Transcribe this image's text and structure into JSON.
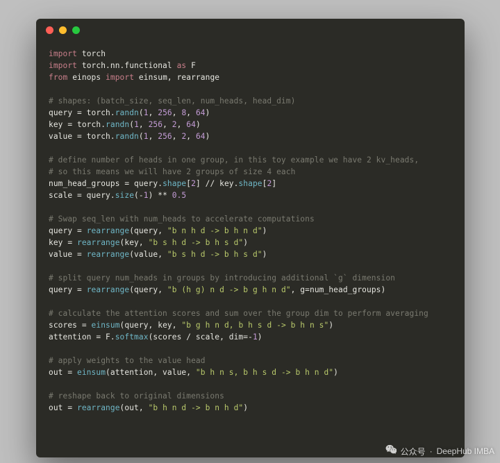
{
  "code": {
    "lines": [
      [
        {
          "t": "import ",
          "c": "kw"
        },
        {
          "t": "torch",
          "c": "mod"
        }
      ],
      [
        {
          "t": "import ",
          "c": "kw"
        },
        {
          "t": "torch.nn.functional ",
          "c": "mod"
        },
        {
          "t": "as ",
          "c": "kw"
        },
        {
          "t": "F",
          "c": "mod"
        }
      ],
      [
        {
          "t": "from ",
          "c": "kw"
        },
        {
          "t": "einops ",
          "c": "mod"
        },
        {
          "t": "import ",
          "c": "kw"
        },
        {
          "t": "einsum, rearrange",
          "c": "mod"
        }
      ],
      [],
      [
        {
          "t": "# shapes: (batch_size, seq_len, num_heads, head_dim)",
          "c": "cmt"
        }
      ],
      [
        {
          "t": "query = torch.",
          "c": "id"
        },
        {
          "t": "randn",
          "c": "fn"
        },
        {
          "t": "(",
          "c": "op"
        },
        {
          "t": "1",
          "c": "num"
        },
        {
          "t": ", ",
          "c": "op"
        },
        {
          "t": "256",
          "c": "num"
        },
        {
          "t": ", ",
          "c": "op"
        },
        {
          "t": "8",
          "c": "num"
        },
        {
          "t": ", ",
          "c": "op"
        },
        {
          "t": "64",
          "c": "num"
        },
        {
          "t": ")",
          "c": "op"
        }
      ],
      [
        {
          "t": "key = torch.",
          "c": "id"
        },
        {
          "t": "randn",
          "c": "fn"
        },
        {
          "t": "(",
          "c": "op"
        },
        {
          "t": "1",
          "c": "num"
        },
        {
          "t": ", ",
          "c": "op"
        },
        {
          "t": "256",
          "c": "num"
        },
        {
          "t": ", ",
          "c": "op"
        },
        {
          "t": "2",
          "c": "num"
        },
        {
          "t": ", ",
          "c": "op"
        },
        {
          "t": "64",
          "c": "num"
        },
        {
          "t": ")",
          "c": "op"
        }
      ],
      [
        {
          "t": "value = torch.",
          "c": "id"
        },
        {
          "t": "randn",
          "c": "fn"
        },
        {
          "t": "(",
          "c": "op"
        },
        {
          "t": "1",
          "c": "num"
        },
        {
          "t": ", ",
          "c": "op"
        },
        {
          "t": "256",
          "c": "num"
        },
        {
          "t": ", ",
          "c": "op"
        },
        {
          "t": "2",
          "c": "num"
        },
        {
          "t": ", ",
          "c": "op"
        },
        {
          "t": "64",
          "c": "num"
        },
        {
          "t": ")",
          "c": "op"
        }
      ],
      [],
      [
        {
          "t": "# define number of heads in one group, in this toy example we have 2 kv_heads,",
          "c": "cmt"
        }
      ],
      [
        {
          "t": "# so this means we will have 2 groups of size 4 each",
          "c": "cmt"
        }
      ],
      [
        {
          "t": "num_head_groups = query.",
          "c": "id"
        },
        {
          "t": "shape",
          "c": "fn"
        },
        {
          "t": "[",
          "c": "op"
        },
        {
          "t": "2",
          "c": "num"
        },
        {
          "t": "] // key.",
          "c": "id"
        },
        {
          "t": "shape",
          "c": "fn"
        },
        {
          "t": "[",
          "c": "op"
        },
        {
          "t": "2",
          "c": "num"
        },
        {
          "t": "]",
          "c": "op"
        }
      ],
      [
        {
          "t": "scale = query.",
          "c": "id"
        },
        {
          "t": "size",
          "c": "fn"
        },
        {
          "t": "(-",
          "c": "op"
        },
        {
          "t": "1",
          "c": "num"
        },
        {
          "t": ") ** ",
          "c": "op"
        },
        {
          "t": "0.5",
          "c": "num"
        }
      ],
      [],
      [
        {
          "t": "# Swap seq_len with num_heads to accelerate computations",
          "c": "cmt"
        }
      ],
      [
        {
          "t": "query = ",
          "c": "id"
        },
        {
          "t": "rearrange",
          "c": "fn"
        },
        {
          "t": "(query, ",
          "c": "id"
        },
        {
          "t": "\"b n h d -> b h n d\"",
          "c": "str"
        },
        {
          "t": ")",
          "c": "op"
        }
      ],
      [
        {
          "t": "key = ",
          "c": "id"
        },
        {
          "t": "rearrange",
          "c": "fn"
        },
        {
          "t": "(key, ",
          "c": "id"
        },
        {
          "t": "\"b s h d -> b h s d\"",
          "c": "str"
        },
        {
          "t": ")",
          "c": "op"
        }
      ],
      [
        {
          "t": "value = ",
          "c": "id"
        },
        {
          "t": "rearrange",
          "c": "fn"
        },
        {
          "t": "(value, ",
          "c": "id"
        },
        {
          "t": "\"b s h d -> b h s d\"",
          "c": "str"
        },
        {
          "t": ")",
          "c": "op"
        }
      ],
      [],
      [
        {
          "t": "# split query num_heads in groups by introducing additional `g` dimension",
          "c": "cmt"
        }
      ],
      [
        {
          "t": "query = ",
          "c": "id"
        },
        {
          "t": "rearrange",
          "c": "fn"
        },
        {
          "t": "(query, ",
          "c": "id"
        },
        {
          "t": "\"b (h g) n d -> b g h n d\"",
          "c": "str"
        },
        {
          "t": ", g=num_head_groups)",
          "c": "id"
        }
      ],
      [],
      [
        {
          "t": "# calculate the attention scores and sum over the group dim to perform averaging",
          "c": "cmt"
        }
      ],
      [
        {
          "t": "scores = ",
          "c": "id"
        },
        {
          "t": "einsum",
          "c": "fn"
        },
        {
          "t": "(query, key, ",
          "c": "id"
        },
        {
          "t": "\"b g h n d, b h s d -> b h n s\"",
          "c": "str"
        },
        {
          "t": ")",
          "c": "op"
        }
      ],
      [
        {
          "t": "attention = F.",
          "c": "id"
        },
        {
          "t": "softmax",
          "c": "fn"
        },
        {
          "t": "(scores / scale, dim=-",
          "c": "id"
        },
        {
          "t": "1",
          "c": "num"
        },
        {
          "t": ")",
          "c": "op"
        }
      ],
      [],
      [
        {
          "t": "# apply weights to the value head",
          "c": "cmt"
        }
      ],
      [
        {
          "t": "out = ",
          "c": "id"
        },
        {
          "t": "einsum",
          "c": "fn"
        },
        {
          "t": "(attention, value, ",
          "c": "id"
        },
        {
          "t": "\"b h n s, b h s d -> b h n d\"",
          "c": "str"
        },
        {
          "t": ")",
          "c": "op"
        }
      ],
      [],
      [
        {
          "t": "# reshape back to original dimensions",
          "c": "cmt"
        }
      ],
      [
        {
          "t": "out = ",
          "c": "id"
        },
        {
          "t": "rearrange",
          "c": "fn"
        },
        {
          "t": "(out, ",
          "c": "id"
        },
        {
          "t": "\"b h n d -> b n h d\"",
          "c": "str"
        },
        {
          "t": ")",
          "c": "op"
        }
      ]
    ]
  },
  "watermark": {
    "label": "公众号",
    "sep": "·",
    "name": "DeepHub IMBA"
  }
}
